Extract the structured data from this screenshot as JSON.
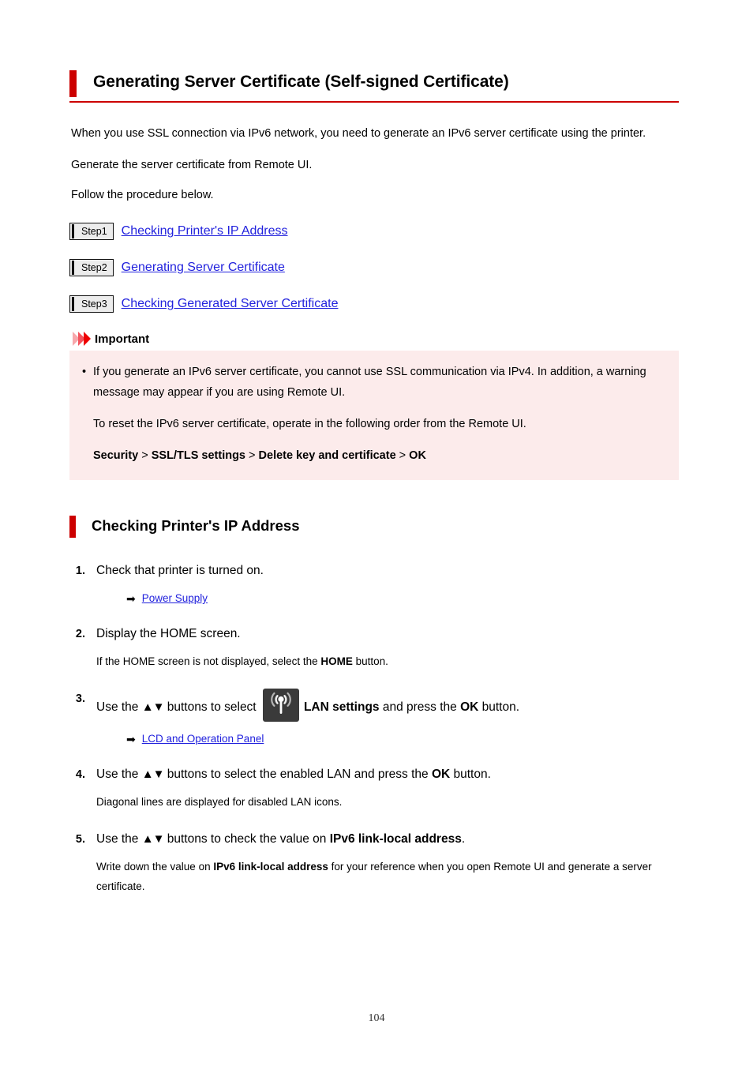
{
  "title": "Generating Server Certificate (Self-signed Certificate)",
  "intro": {
    "p1": "When you use SSL connection via IPv6 network, you need to generate an IPv6 server certificate using the printer.",
    "p2": "Generate the server certificate from Remote UI.",
    "p3": "Follow the procedure below."
  },
  "steps": [
    {
      "badge": "Step1",
      "link": "Checking Printer's IP Address"
    },
    {
      "badge": "Step2",
      "link": "Generating Server Certificate"
    },
    {
      "badge": "Step3",
      "link": "Checking Generated Server Certificate"
    }
  ],
  "important": {
    "label": "Important",
    "bullet_marker": "•",
    "bullet": "If you generate an IPv6 server certificate, you cannot use SSL communication via IPv4. In addition, a warning message may appear if you are using Remote UI.",
    "paragraph": "To reset the IPv6 server certificate, operate in the following order from the Remote UI.",
    "path": {
      "item1": "Security",
      "sep1": " > ",
      "item2": "SSL/TLS settings",
      "sep2": " > ",
      "item3": "Delete key and certificate",
      "sep3": " > ",
      "item4": "OK"
    }
  },
  "section": {
    "heading": "Checking Printer's IP Address",
    "items": [
      {
        "num": "1.",
        "text": "Check that printer is turned on.",
        "link": "Power Supply",
        "arrow": "➡"
      },
      {
        "num": "2.",
        "text": "Display the HOME screen.",
        "sub_pre": "If the HOME screen is not displayed, select the ",
        "sub_bold": "HOME",
        "sub_post": " button."
      },
      {
        "num": "3.",
        "pre": "Use the ",
        "triangles": "▲▼",
        "mid": " buttons to select ",
        "icon_name": "wireless-lan-icon",
        "bold1": "LAN settings",
        "mid2": " and press the ",
        "bold2": "OK",
        "post": " button.",
        "link": "LCD and Operation Panel",
        "arrow": "➡"
      },
      {
        "num": "4.",
        "pre": "Use the ",
        "triangles": "▲▼",
        "mid": " buttons to select the enabled LAN and press the ",
        "bold2": "OK",
        "post": " button.",
        "sub": "Diagonal lines are displayed for disabled LAN icons."
      },
      {
        "num": "5.",
        "pre": "Use the ",
        "triangles": "▲▼",
        "mid": " buttons to check the value on ",
        "bold1": "IPv6 link-local address",
        "post": ".",
        "sub_pre": "Write down the value on ",
        "sub_bold": "IPv6 link-local address",
        "sub_post": " for your reference when you open Remote UI and generate a server certificate."
      }
    ]
  },
  "footer": {
    "page_number": "104"
  },
  "colors": {
    "accent_red": "#cc0000",
    "link_blue": "#2222dd",
    "callout_bg": "#fcebeb",
    "badge_bg": "#ececec",
    "icon_bg": "#3a3a3a"
  }
}
